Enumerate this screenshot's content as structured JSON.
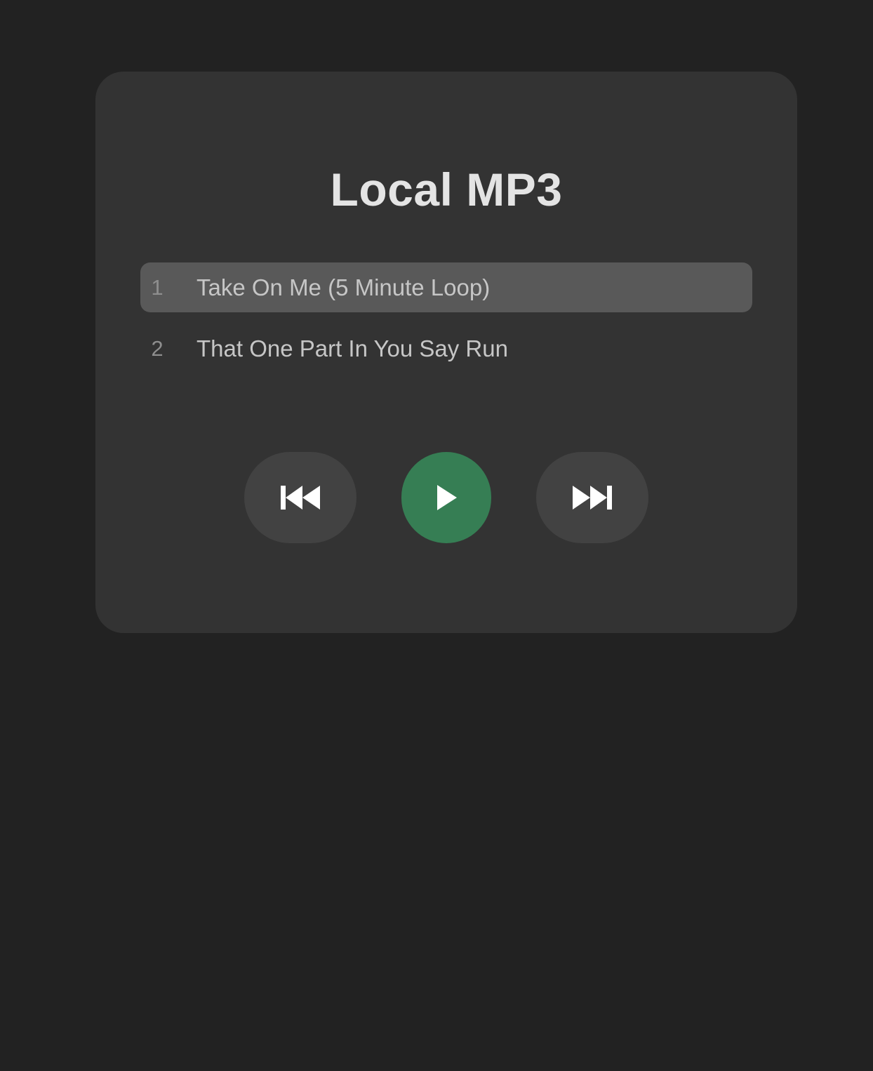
{
  "player": {
    "title": "Local MP3",
    "colors": {
      "background": "#222222",
      "card": "#333333",
      "active_track": "#595959",
      "control_button": "#424242",
      "play_button": "#367E54"
    },
    "tracks": [
      {
        "number": "1",
        "title": "Take On Me (5 Minute Loop)",
        "active": true
      },
      {
        "number": "2",
        "title": "That One Part In You Say Run",
        "active": false
      }
    ],
    "controls": {
      "previous_icon": "skip-previous-icon",
      "play_icon": "play-icon",
      "next_icon": "skip-next-icon"
    }
  }
}
